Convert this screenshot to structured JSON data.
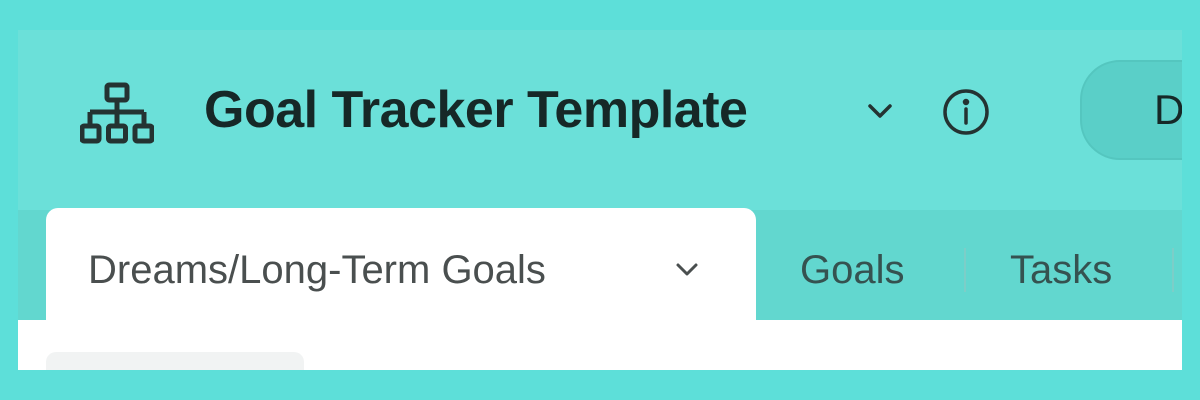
{
  "header": {
    "title": "Goal Tracker Template",
    "view_button_label": "Da"
  },
  "tabs": [
    {
      "label": "Dreams/Long-Term Goals",
      "active": true
    },
    {
      "label": "Goals",
      "active": false
    },
    {
      "label": "Tasks",
      "active": false
    }
  ],
  "icons": {
    "app": "hierarchy-icon",
    "title_menu": "chevron-down-icon",
    "info": "info-icon",
    "tab_menu": "chevron-down-icon"
  },
  "colors": {
    "page_background": "#5ddfd9",
    "header_background": "#6be0d9",
    "tabbar_background": "#62d7cf",
    "text_dark": "#162827"
  }
}
